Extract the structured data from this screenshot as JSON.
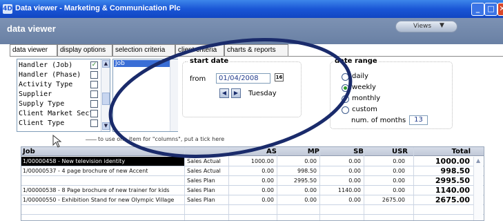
{
  "window": {
    "title": "Data viewer - Marketing & Communication Plc",
    "app_icon": "4D",
    "minimize": "_",
    "maximize": "□",
    "close": "✕"
  },
  "header": {
    "heading": "data viewer"
  },
  "views": {
    "label": "Views",
    "arrow": "▼"
  },
  "tabs": [
    {
      "label": "data viewer",
      "active": true
    },
    {
      "label": "display options",
      "active": false
    },
    {
      "label": "selection criteria",
      "active": false
    },
    {
      "label": "client criteria",
      "active": false
    },
    {
      "label": "charts & reports",
      "active": false
    }
  ],
  "column_list": {
    "items": [
      {
        "label": "Handler (Job)",
        "checked": true
      },
      {
        "label": "Handler (Phase)",
        "checked": false
      },
      {
        "label": "Activity Type",
        "checked": false
      },
      {
        "label": "Supplier",
        "checked": false
      },
      {
        "label": "Supply Type",
        "checked": false
      },
      {
        "label": "Client Market Secto",
        "checked": false
      },
      {
        "label": "Client Type",
        "checked": false
      }
    ],
    "check_glyph": "✓",
    "up_arrow": "▲",
    "down_arrow": "▼"
  },
  "selected_list": {
    "items": [
      "Job"
    ]
  },
  "hint": "to use one item for \"columns\", put a tick here",
  "start_date": {
    "title": "start date",
    "from_label": "from",
    "date_value": "01/04/2008",
    "calendar_label": "16",
    "prev": "◀",
    "next": "▶",
    "day": "Tuesday"
  },
  "date_range": {
    "title": "date range",
    "options": [
      {
        "label": "daily",
        "selected": false
      },
      {
        "label": "weekly",
        "selected": true
      },
      {
        "label": "monthly",
        "selected": false
      },
      {
        "label": "custom",
        "selected": false
      }
    ],
    "months_label": "num. of months",
    "months_value": "13"
  },
  "table": {
    "headers": {
      "job": "Job",
      "type": "",
      "as": "AS",
      "mp": "MP",
      "sb": "SB",
      "usr": "USR",
      "total": "Total"
    },
    "rows": [
      {
        "job": "1/00000458 - New television identity",
        "type": "Sales Actual",
        "as": "1000.00",
        "mp": "0.00",
        "sb": "0.00",
        "usr": "0.00",
        "total": "1000.00",
        "highlight": true
      },
      {
        "job": "1/00000537 - 4 page brochure of new Accent",
        "type": "Sales Actual",
        "as": "0.00",
        "mp": "998.50",
        "sb": "0.00",
        "usr": "0.00",
        "total": "998.50",
        "highlight": false
      },
      {
        "job": "",
        "type": "Sales Plan",
        "as": "0.00",
        "mp": "2995.50",
        "sb": "0.00",
        "usr": "0.00",
        "total": "2995.50",
        "highlight": false
      },
      {
        "job": "1/00000538 - 8 Page brochure of new trainer for kids",
        "type": "Sales Plan",
        "as": "0.00",
        "mp": "0.00",
        "sb": "1140.00",
        "usr": "0.00",
        "total": "1140.00",
        "highlight": false
      },
      {
        "job": "1/00000550 - Exhibition Stand for new Olympic Village",
        "type": "Sales Plan",
        "as": "0.00",
        "mp": "0.00",
        "sb": "0.00",
        "usr": "2675.00",
        "total": "2675.00",
        "highlight": false
      }
    ],
    "scroll_up": "▲"
  },
  "colors": {
    "annotation_oval": "#1a2b6b",
    "title_bar": "#1a56d6",
    "header_band": "#7489ad",
    "highlight_row": "#000000"
  }
}
